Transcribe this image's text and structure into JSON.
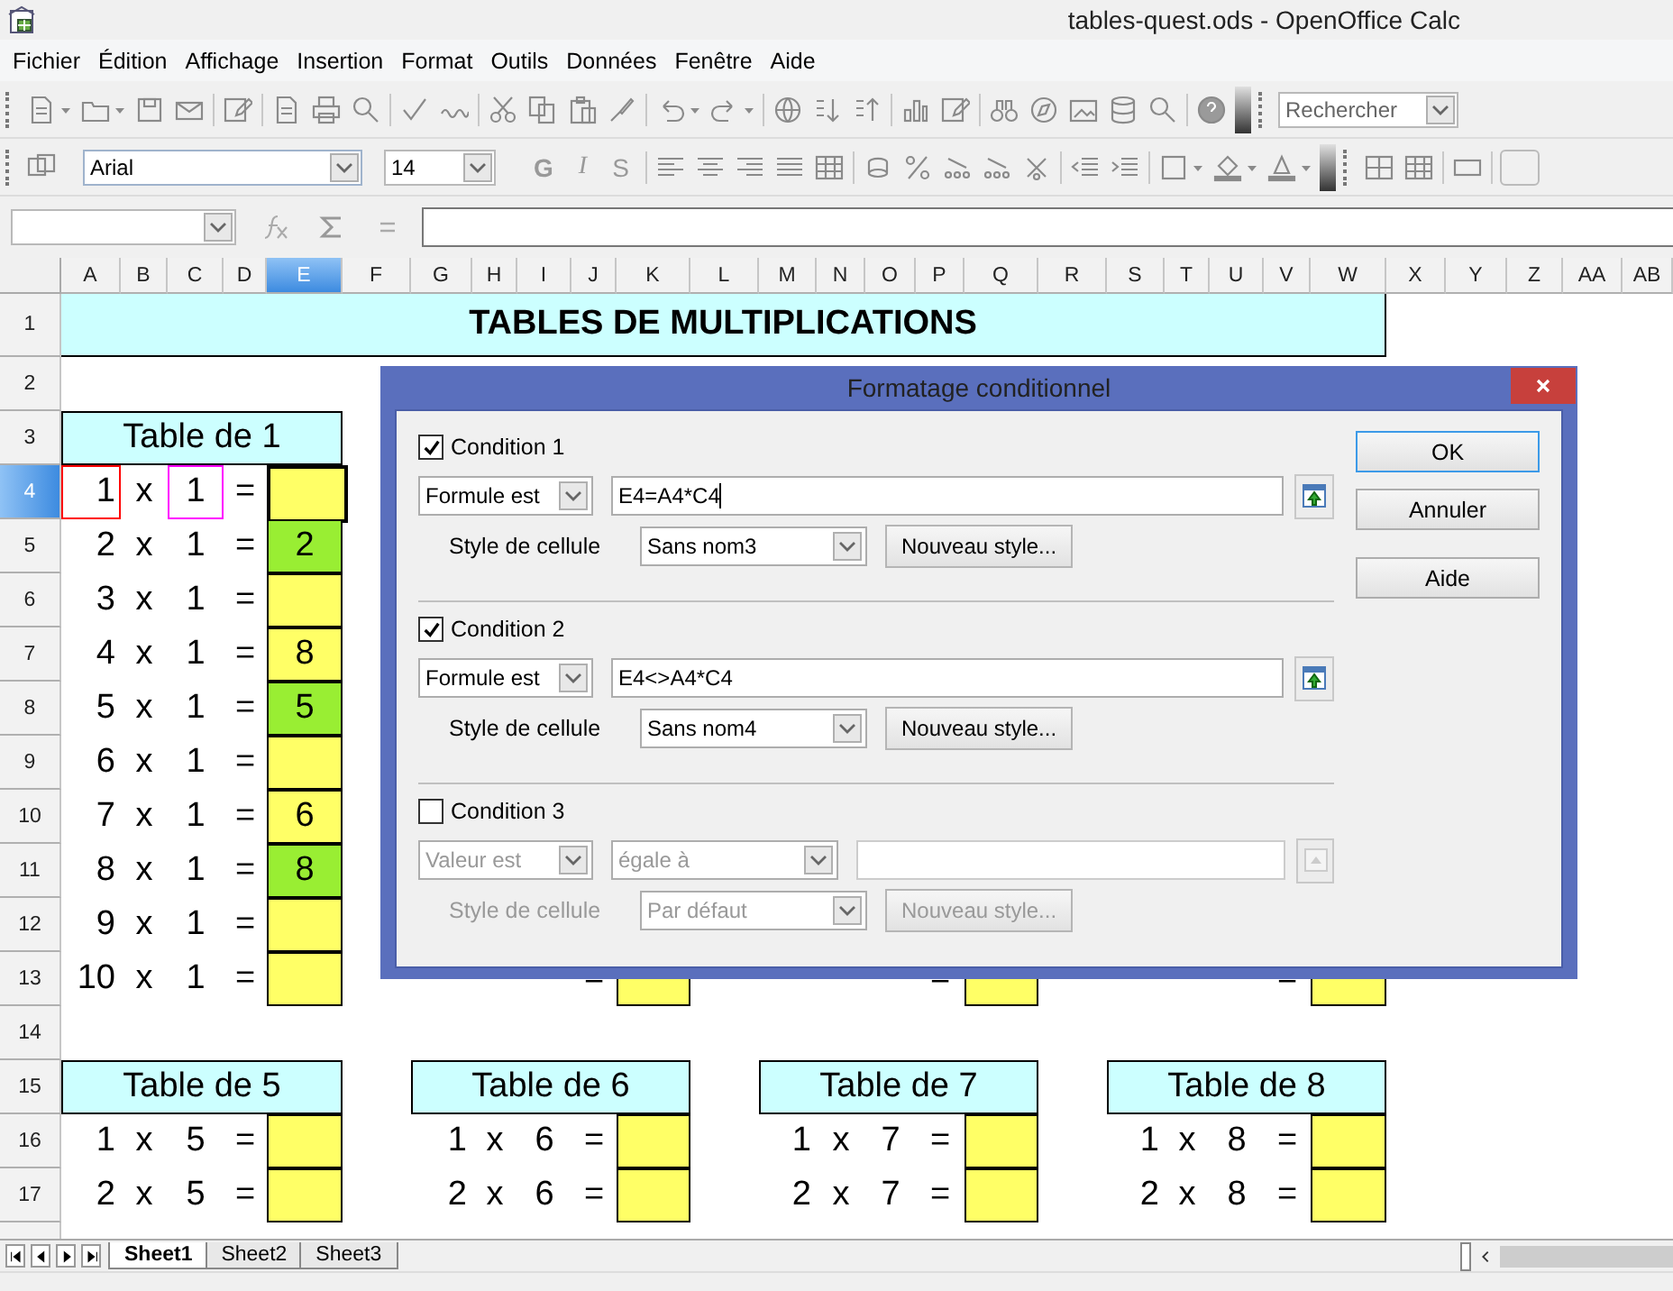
{
  "window": {
    "title": "tables-quest.ods - OpenOffice Calc"
  },
  "menu": [
    "Fichier",
    "Édition",
    "Affichage",
    "Insertion",
    "Format",
    "Outils",
    "Données",
    "Fenêtre",
    "Aide"
  ],
  "search": {
    "value": "Rechercher"
  },
  "formatting": {
    "font": "Arial",
    "size": "14",
    "style_buttons": [
      "G",
      "I",
      "S"
    ]
  },
  "sheet": {
    "title": "TABLES DE MULTIPLICATIONS",
    "columns": [
      {
        "label": "A",
        "selected": false
      },
      {
        "label": "B",
        "selected": false
      },
      {
        "label": "C",
        "selected": false
      },
      {
        "label": "D",
        "selected": false
      },
      {
        "label": "E",
        "selected": true
      },
      {
        "label": "F",
        "selected": false
      },
      {
        "label": "G",
        "selected": false
      },
      {
        "label": "H",
        "selected": false
      },
      {
        "label": "I",
        "selected": false
      },
      {
        "label": "J",
        "selected": false
      },
      {
        "label": "K",
        "selected": false
      },
      {
        "label": "L",
        "selected": false
      },
      {
        "label": "M",
        "selected": false
      },
      {
        "label": "N",
        "selected": false
      },
      {
        "label": "O",
        "selected": false
      },
      {
        "label": "P",
        "selected": false
      },
      {
        "label": "Q",
        "selected": false
      },
      {
        "label": "R",
        "selected": false
      },
      {
        "label": "S",
        "selected": false
      },
      {
        "label": "T",
        "selected": false
      },
      {
        "label": "U",
        "selected": false
      },
      {
        "label": "V",
        "selected": false
      },
      {
        "label": "W",
        "selected": false
      },
      {
        "label": "X",
        "selected": false
      },
      {
        "label": "Y",
        "selected": false
      },
      {
        "label": "Z",
        "selected": false
      },
      {
        "label": "AA",
        "selected": false
      },
      {
        "label": "AB",
        "selected": false
      }
    ],
    "rows": [
      {
        "label": "1",
        "selected": false
      },
      {
        "label": "2",
        "selected": false
      },
      {
        "label": "3",
        "selected": false
      },
      {
        "label": "4",
        "selected": true
      },
      {
        "label": "5",
        "selected": false
      },
      {
        "label": "6",
        "selected": false
      },
      {
        "label": "7",
        "selected": false
      },
      {
        "label": "8",
        "selected": false
      },
      {
        "label": "9",
        "selected": false
      },
      {
        "label": "10",
        "selected": false
      },
      {
        "label": "11",
        "selected": false
      },
      {
        "label": "12",
        "selected": false
      },
      {
        "label": "13",
        "selected": false
      },
      {
        "label": "14",
        "selected": false
      },
      {
        "label": "15",
        "selected": false
      },
      {
        "label": "16",
        "selected": false
      },
      {
        "label": "17",
        "selected": false
      }
    ],
    "tables": [
      {
        "title": "Table de 1",
        "rows": [
          {
            "n": "1",
            "op": "x",
            "m": "1",
            "eq": "=",
            "answer": "",
            "color": "#ffff66",
            "selected": true,
            "n_ref": {
              "color": "#ff0000"
            },
            "m_ref": {
              "color": "#ff00ff"
            }
          },
          {
            "n": "2",
            "op": "x",
            "m": "1",
            "eq": "=",
            "answer": "2",
            "color": "#99ee33",
            "selected": false
          },
          {
            "n": "3",
            "op": "x",
            "m": "1",
            "eq": "=",
            "answer": "",
            "color": "#ffff66",
            "selected": false
          },
          {
            "n": "4",
            "op": "x",
            "m": "1",
            "eq": "=",
            "answer": "8",
            "color": "#ffff66",
            "selected": false
          },
          {
            "n": "5",
            "op": "x",
            "m": "1",
            "eq": "=",
            "answer": "5",
            "color": "#99ee33",
            "selected": false
          },
          {
            "n": "6",
            "op": "x",
            "m": "1",
            "eq": "=",
            "answer": "",
            "color": "#ffff66",
            "selected": false
          },
          {
            "n": "7",
            "op": "x",
            "m": "1",
            "eq": "=",
            "answer": "6",
            "color": "#ffff66",
            "selected": false
          },
          {
            "n": "8",
            "op": "x",
            "m": "1",
            "eq": "=",
            "answer": "8",
            "color": "#99ee33",
            "selected": false
          },
          {
            "n": "9",
            "op": "x",
            "m": "1",
            "eq": "=",
            "answer": "",
            "color": "#ffff66",
            "selected": false
          },
          {
            "n": "10",
            "op": "x",
            "m": "1",
            "eq": "=",
            "answer": "",
            "color": "#ffff66",
            "selected": false
          }
        ]
      },
      {
        "rows": [
          {
            "eq": "=",
            "answer": "",
            "color": "#ffff66",
            "selected": false
          }
        ]
      },
      {
        "rows": [
          {
            "eq": "=",
            "answer": "",
            "color": "#ffff66",
            "selected": false
          }
        ]
      },
      {
        "rows": [
          {
            "eq": "=",
            "answer": "",
            "color": "#ffff66",
            "selected": false
          }
        ]
      },
      {
        "title": "Table de 5",
        "rows": [
          {
            "n": "1",
            "op": "x",
            "m": "5",
            "eq": "=",
            "answer": "",
            "color": "#ffff66",
            "selected": false
          },
          {
            "n": "2",
            "op": "x",
            "m": "5",
            "eq": "=",
            "answer": "",
            "color": "#ffff66",
            "selected": false
          }
        ]
      },
      {
        "title": "Table de 6",
        "rows": [
          {
            "n": "1",
            "op": "x",
            "m": "6",
            "eq": "=",
            "answer": "",
            "color": "#ffff66",
            "selected": false
          },
          {
            "n": "2",
            "op": "x",
            "m": "6",
            "eq": "=",
            "answer": "",
            "color": "#ffff66",
            "selected": false
          }
        ]
      },
      {
        "title": "Table de 7",
        "rows": [
          {
            "n": "1",
            "op": "x",
            "m": "7",
            "eq": "=",
            "answer": "",
            "color": "#ffff66",
            "selected": false
          },
          {
            "n": "2",
            "op": "x",
            "m": "7",
            "eq": "=",
            "answer": "",
            "color": "#ffff66",
            "selected": false
          }
        ]
      },
      {
        "title": "Table de 8",
        "rows": [
          {
            "n": "1",
            "op": "x",
            "m": "8",
            "eq": "=",
            "answer": "",
            "color": "#ffff66",
            "selected": false
          },
          {
            "n": "2",
            "op": "x",
            "m": "8",
            "eq": "=",
            "answer": "",
            "color": "#ffff66",
            "selected": false
          }
        ]
      }
    ]
  },
  "sheet_tabs": [
    {
      "label": "Sheet1",
      "selected": true
    },
    {
      "label": "Sheet2",
      "selected": false
    },
    {
      "label": "Sheet3",
      "selected": false
    }
  ],
  "dialog": {
    "title": "Formatage conditionnel",
    "conditions": [
      {
        "label": "Condition 1",
        "checked": true,
        "disabled": false,
        "kind": "formula",
        "operator": "Formule est",
        "formula": "E4=A4*C4",
        "style_label": "Style de cellule",
        "style": "Sans nom3",
        "new_style": "Nouveau style..."
      },
      {
        "label": "Condition 2",
        "checked": true,
        "disabled": false,
        "kind": "formula",
        "operator": "Formule est",
        "formula": "E4<>A4*C4",
        "style_label": "Style de cellule",
        "style": "Sans nom4",
        "new_style": "Nouveau style..."
      },
      {
        "label": "Condition 3",
        "checked": false,
        "disabled": true,
        "kind": "value",
        "operator": "Valeur est",
        "comparison": "égale à",
        "style_label": "Style de cellule",
        "style": "Par défaut",
        "new_style": "Nouveau style..."
      }
    ],
    "buttons": [
      {
        "label": "OK",
        "default": true
      },
      {
        "label": "Annuler",
        "default": false
      },
      {
        "label": "Aide",
        "default": false
      }
    ]
  }
}
